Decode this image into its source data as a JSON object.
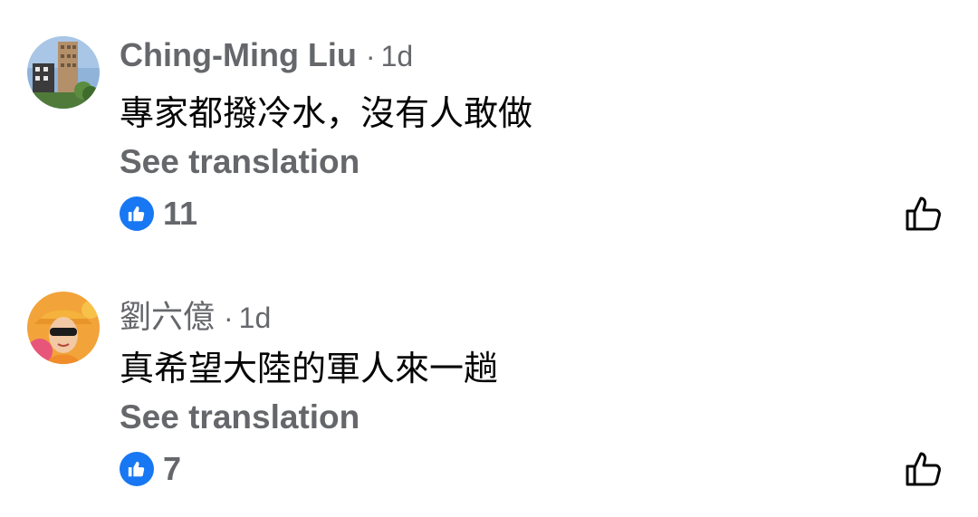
{
  "comments": [
    {
      "author": "Ching-Ming Liu",
      "time": "1d",
      "separator": "·",
      "text": "專家都撥冷水，沒有人敢做",
      "translate_label": "See translation",
      "reaction_count": "11",
      "avatar_icon": "building-photo-avatar"
    },
    {
      "author": "劉六億",
      "time": "1d",
      "separator": "·",
      "text": "真希望大陸的軍人來一趟",
      "translate_label": "See translation",
      "reaction_count": "7",
      "avatar_icon": "person-orange-hat-avatar"
    }
  ],
  "colors": {
    "secondary_text": "#65676b",
    "primary_text": "#050505",
    "like_blue": "#1877f2"
  }
}
